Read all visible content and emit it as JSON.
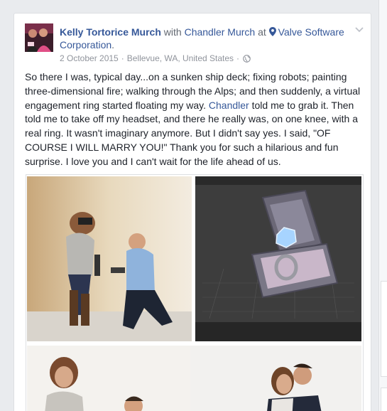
{
  "post": {
    "author": "Kelly Tortorice Murch",
    "with_word": "with",
    "tagged": "Chandler Murch",
    "at_word": "at",
    "place": "Valve Software Corporation",
    "place_suffix": ".",
    "date": "2 October 2015",
    "location": "Bellevue, WA, United States",
    "separator": "·",
    "text_part1": "So there I was, typical day...on a sunken ship deck; fixing robots; painting three-dimensional fire; walking through the Alps; and then suddenly, a virtual engagement ring started floating my way. ",
    "text_mention": "Chandler",
    "text_part2": " told me to grab it. Then told me to take off my headset, and there he really was, on one knee, with a real ring. It wasn't imaginary anymore. But I didn't say yes. I said, \"OF COURSE I WILL MARRY YOU!\" Thank you for such a hilarious and fun surprise. I love you and I can't wait for the life ahead of us."
  },
  "icons": {
    "pin": "location-pin-icon",
    "globe": "globe-icon",
    "chevron": "chevron-down-icon"
  },
  "colors": {
    "link": "#365899",
    "text": "#1d2129",
    "muted": "#90949c",
    "background": "#e9ebee"
  }
}
